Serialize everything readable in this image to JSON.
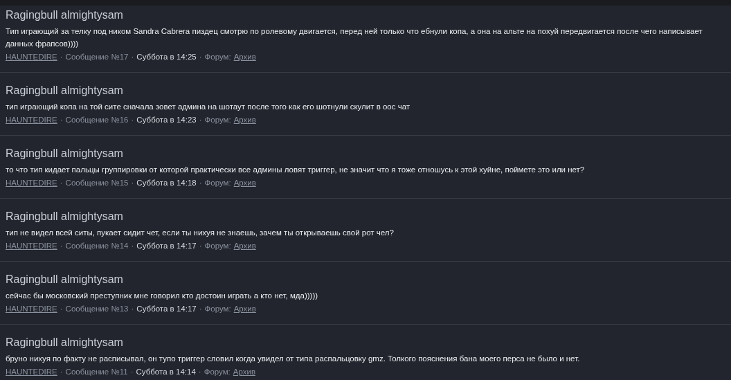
{
  "posts": [
    {
      "title": "Ragingbull almightysam",
      "body": "Тип играющий за телку под ником Sandra Cabrera пиздец смотрю по ролевому двигается, перед ней только что ебнули копа, а она на альте на похуй передвигается после чего написывает данных фрапсов))))",
      "meta": [
        {
          "kind": "link",
          "text": "HAUNTEDIRE"
        },
        {
          "kind": "sep",
          "text": "·"
        },
        {
          "kind": "text",
          "text": "Сообщение №17"
        },
        {
          "kind": "sep",
          "text": "·"
        },
        {
          "kind": "time",
          "text": "Суббота в 14:25"
        },
        {
          "kind": "sep",
          "text": "·"
        },
        {
          "kind": "text",
          "text": "Форум:"
        },
        {
          "kind": "link",
          "text": "Архив"
        }
      ]
    },
    {
      "title": "Ragingbull almightysam",
      "body": "тип играющий копа на той сите сначала зовет админа на шотаут после того как его шотнули скулит в оос чат",
      "meta": [
        {
          "kind": "link",
          "text": "HAUNTEDIRE"
        },
        {
          "kind": "sep",
          "text": "·"
        },
        {
          "kind": "text",
          "text": "Сообщение №16"
        },
        {
          "kind": "sep",
          "text": "·"
        },
        {
          "kind": "time",
          "text": "Суббота в 14:23"
        },
        {
          "kind": "sep",
          "text": "·"
        },
        {
          "kind": "text",
          "text": "Форум:"
        },
        {
          "kind": "link",
          "text": "Архив"
        }
      ]
    },
    {
      "title": "Ragingbull almightysam",
      "body": "то что тип кидает пальцы группировки от которой практически все админы ловят триггер, не значит что я тоже отношусь к этой хуйне, поймете это или нет?",
      "meta": [
        {
          "kind": "link",
          "text": "HAUNTEDIRE"
        },
        {
          "kind": "sep",
          "text": "·"
        },
        {
          "kind": "text",
          "text": "Сообщение №15"
        },
        {
          "kind": "sep",
          "text": "·"
        },
        {
          "kind": "time",
          "text": "Суббота в 14:18"
        },
        {
          "kind": "sep",
          "text": "·"
        },
        {
          "kind": "text",
          "text": "Форум:"
        },
        {
          "kind": "link",
          "text": "Архив"
        }
      ]
    },
    {
      "title": "Ragingbull almightysam",
      "body": "тип не видел всей ситы, пукает сидит чет, если ты нихуя не знаешь, зачем ты открываешь свой рот чел?",
      "meta": [
        {
          "kind": "link",
          "text": "HAUNTEDIRE"
        },
        {
          "kind": "sep",
          "text": "·"
        },
        {
          "kind": "text",
          "text": "Сообщение №14"
        },
        {
          "kind": "sep",
          "text": "·"
        },
        {
          "kind": "time",
          "text": "Суббота в 14:17"
        },
        {
          "kind": "sep",
          "text": "·"
        },
        {
          "kind": "text",
          "text": "Форум:"
        },
        {
          "kind": "link",
          "text": "Архив"
        }
      ]
    },
    {
      "title": "Ragingbull almightysam",
      "body": "сейчас бы московский преступник мне говорил кто достоин играть а кто нет, мда)))))",
      "meta": [
        {
          "kind": "link",
          "text": "HAUNTEDIRE"
        },
        {
          "kind": "sep",
          "text": "·"
        },
        {
          "kind": "text",
          "text": "Сообщение №13"
        },
        {
          "kind": "sep",
          "text": "·"
        },
        {
          "kind": "time",
          "text": "Суббота в 14:17"
        },
        {
          "kind": "sep",
          "text": "·"
        },
        {
          "kind": "text",
          "text": "Форум:"
        },
        {
          "kind": "link",
          "text": "Архив"
        }
      ]
    },
    {
      "title": "Ragingbull almightysam",
      "body": "бруно нихуя по факту не расписывал, он тупо триггер словил когда увидел от типа распальцовку gmz. Толкого пояснения бана моего перса не было и нет.",
      "meta": [
        {
          "kind": "link",
          "text": "HAUNTEDIRE"
        },
        {
          "kind": "sep",
          "text": "·"
        },
        {
          "kind": "text",
          "text": "Сообщение №11"
        },
        {
          "kind": "sep",
          "text": "·"
        },
        {
          "kind": "time",
          "text": "Суббота в 14:14"
        },
        {
          "kind": "sep",
          "text": "·"
        },
        {
          "kind": "text",
          "text": "Форум:"
        },
        {
          "kind": "link",
          "text": "Архив"
        }
      ]
    }
  ]
}
